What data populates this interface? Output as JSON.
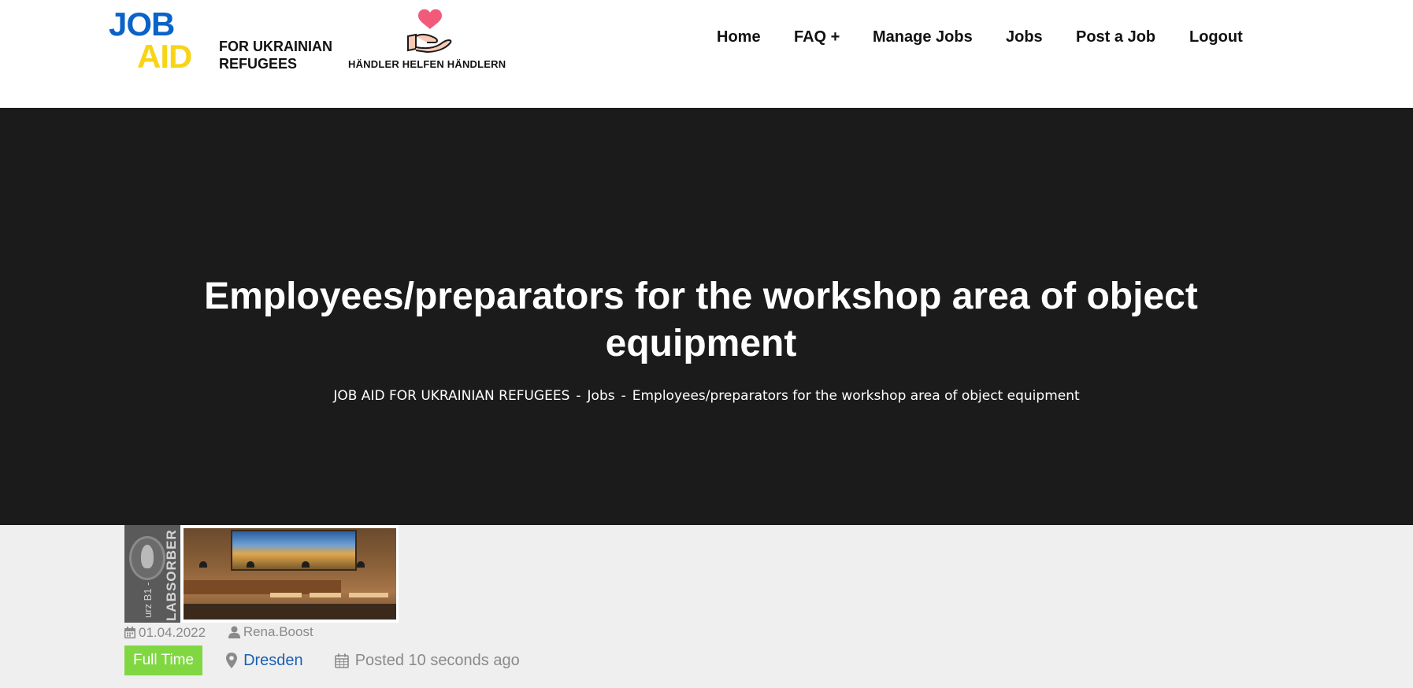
{
  "header": {
    "logo": {
      "word_1": "JOB",
      "word_2": "AID",
      "subtitle_line_1": "FOR UKRAINIAN",
      "subtitle_line_2": "REFUGEES",
      "colors": {
        "blue": "#0a63c7",
        "yellow": "#f7d417"
      }
    },
    "partner_logo": {
      "text": "HÄNDLER HELFEN HÄNDLERN",
      "heart_color": "#f25a7c"
    },
    "nav": [
      {
        "label": "Home"
      },
      {
        "label": "FAQ +"
      },
      {
        "label": "Manage Jobs"
      },
      {
        "label": "Jobs"
      },
      {
        "label": "Post a Job"
      },
      {
        "label": "Logout"
      }
    ]
  },
  "hero": {
    "title_line_1": "Employees/preparators for the workshop area of object",
    "title_line_2": "equipment",
    "breadcrumb": [
      "JOB AID FOR UKRAINIAN REFUGEES",
      "Jobs",
      "Employees/preparators for the workshop area of object equipment"
    ],
    "breadcrumb_separator": "-",
    "background": "#1b1b1b"
  },
  "job": {
    "image_text": {
      "absorber_label": "LABSORBER",
      "absorber_small": "urz B1 -"
    },
    "date": "01.04.2022",
    "author": "Rena.Boost",
    "type": "Full Time",
    "type_color": "#81d742",
    "location": "Dresden",
    "posted": "Posted 10 seconds ago",
    "icons": {
      "date": "calendar-icon",
      "author": "user-icon",
      "location": "map-marker-icon",
      "posted": "calendar-outline-icon"
    }
  }
}
